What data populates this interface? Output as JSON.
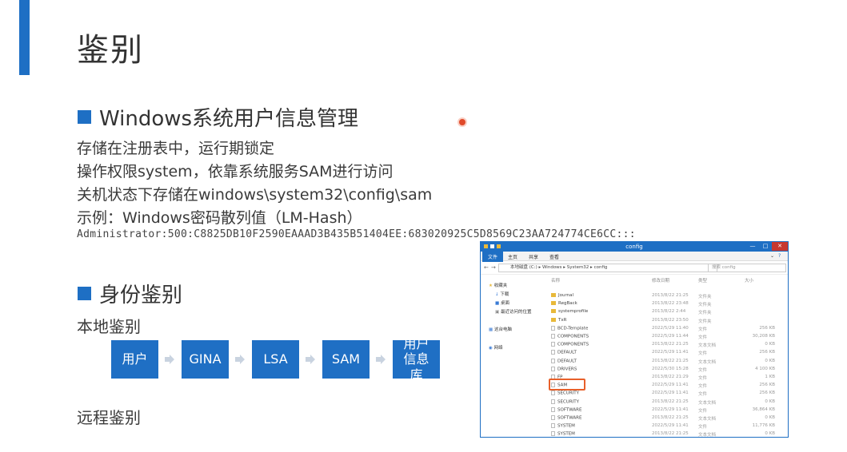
{
  "title": "鉴别",
  "section1": {
    "heading": "Windows系统用户信息管理",
    "lines": [
      "存储在注册表中，运行期锁定",
      "操作权限system，依靠系统服务SAM进行访问",
      "关机状态下存储在windows\\system32\\config\\sam",
      "示例：Windows密码散列值（LM-Hash）"
    ],
    "hash": "Administrator:500:C8825DB10F2590EAAAD3B435B51404EE:683020925C5D8569C23AA724774CE6CC:::"
  },
  "section2": {
    "heading": "身份鉴别",
    "local_label": "本地鉴别",
    "remote_label": "远程鉴别",
    "flow": [
      "用户",
      "GINA",
      "LSA",
      "SAM",
      "用户信息库"
    ]
  },
  "explorer": {
    "title": "config",
    "ribbon_tabs": [
      "文件",
      "主页",
      "共享",
      "查看"
    ],
    "path": "本地磁盘 (C:) ▸ Windows ▸ System32 ▸ config",
    "search_placeholder": "搜索 config",
    "columns": [
      "名称",
      "修改日期",
      "类型",
      "大小"
    ],
    "nav": [
      "收藏夹",
      "下载",
      "桌面",
      "最近访问的位置",
      "这台电脑",
      "网络"
    ],
    "files": [
      {
        "name": "Journal",
        "date": "2013/8/22 21:25",
        "type": "文件夹",
        "size": "",
        "folder": true
      },
      {
        "name": "RegBack",
        "date": "2013/8/22 23:48",
        "type": "文件夹",
        "size": "",
        "folder": true
      },
      {
        "name": "systemprofile",
        "date": "2013/8/22 2:44",
        "type": "文件夹",
        "size": "",
        "folder": true
      },
      {
        "name": "TxR",
        "date": "2013/8/22 23:50",
        "type": "文件夹",
        "size": "",
        "folder": true
      },
      {
        "name": "BCD-Template",
        "date": "2022/5/29 11:40",
        "type": "文件",
        "size": "256 KB",
        "folder": false
      },
      {
        "name": "COMPONENTS",
        "date": "2022/5/29 11:44",
        "type": "文件",
        "size": "30,208 KB",
        "folder": false
      },
      {
        "name": "COMPONENTS",
        "date": "2013/8/22 21:25",
        "type": "文本文档",
        "size": "0 KB",
        "folder": false
      },
      {
        "name": "DEFAULT",
        "date": "2022/5/29 11:41",
        "type": "文件",
        "size": "256 KB",
        "folder": false
      },
      {
        "name": "DEFAULT",
        "date": "2013/8/22 21:25",
        "type": "文本文档",
        "size": "0 KB",
        "folder": false
      },
      {
        "name": "DRIVERS",
        "date": "2022/5/30 15:28",
        "type": "文件",
        "size": "4 100 KB",
        "folder": false
      },
      {
        "name": "FP",
        "date": "2013/8/22 21:29",
        "type": "文件",
        "size": "1 KB",
        "folder": false
      },
      {
        "name": "SAM",
        "date": "2022/5/29 11:41",
        "type": "文件",
        "size": "256 KB",
        "folder": false
      },
      {
        "name": "SECURITY",
        "date": "2022/5/29 11:41",
        "type": "文件",
        "size": "256 KB",
        "folder": false
      },
      {
        "name": "SECURITY",
        "date": "2013/8/22 21:25",
        "type": "文本文档",
        "size": "0 KB",
        "folder": false
      },
      {
        "name": "SOFTWARE",
        "date": "2022/5/29 11:41",
        "type": "文件",
        "size": "36,864 KB",
        "folder": false
      },
      {
        "name": "SOFTWARE",
        "date": "2013/8/22 21:25",
        "type": "文本文档",
        "size": "0 KB",
        "folder": false
      },
      {
        "name": "SYSTEM",
        "date": "2022/5/29 11:41",
        "type": "文件",
        "size": "11,776 KB",
        "folder": false
      },
      {
        "name": "SYSTEM",
        "date": "2013/8/22 21:25",
        "type": "文本文档",
        "size": "0 KB",
        "folder": false
      }
    ]
  },
  "colors": {
    "accent": "#1e6fc4",
    "highlight": "#e8602a"
  }
}
